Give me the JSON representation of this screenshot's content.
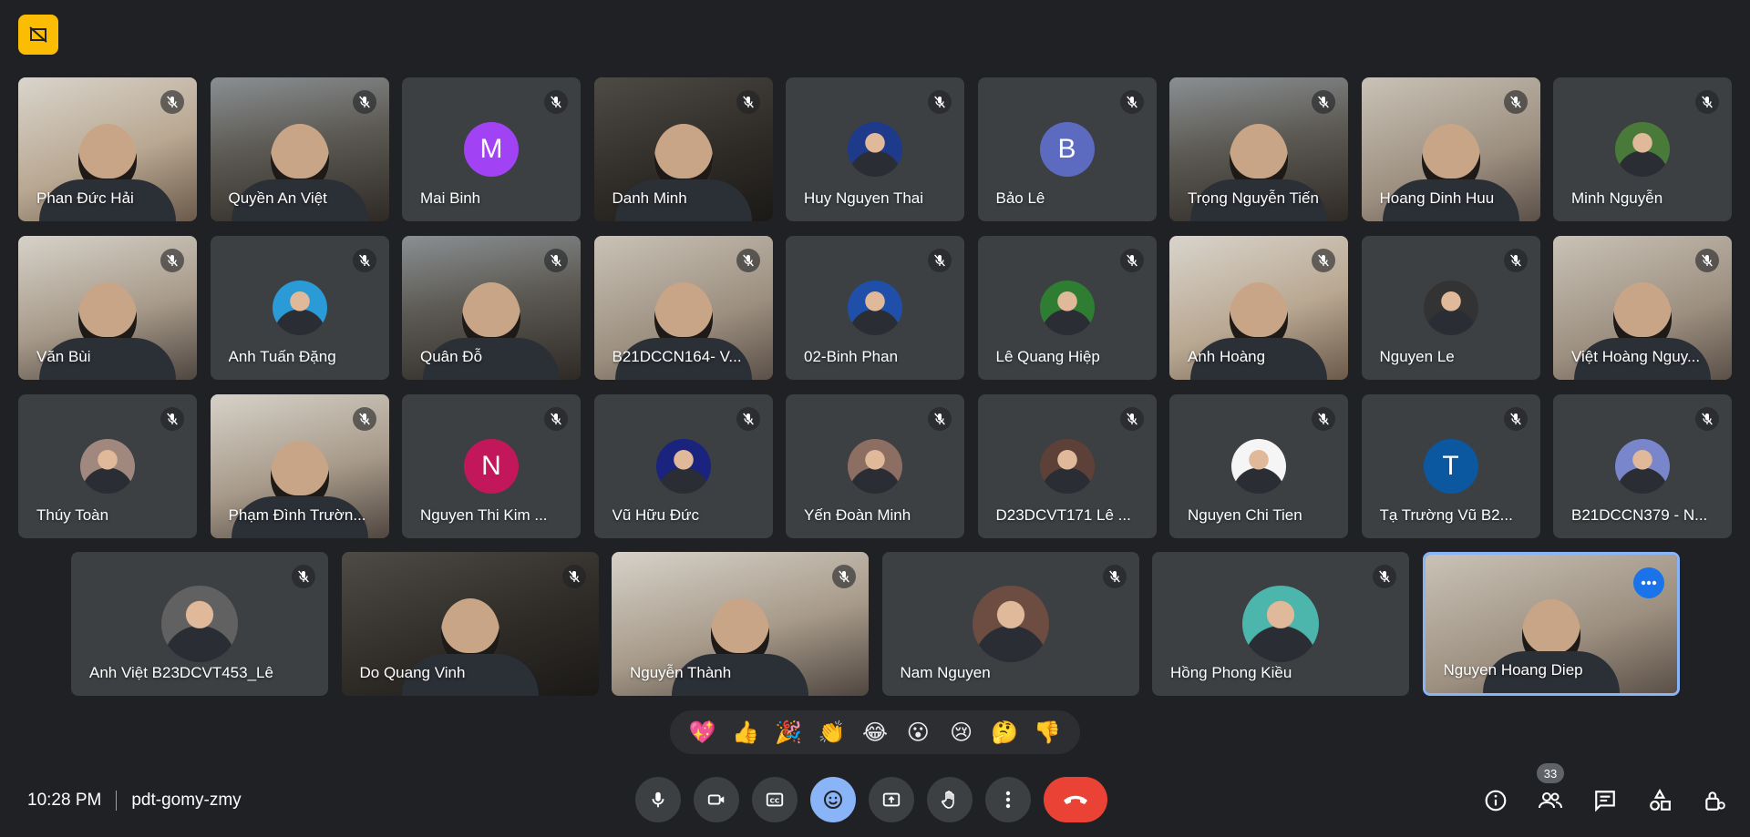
{
  "meeting": {
    "time": "10:28 PM",
    "code": "pdt-gomy-zmy",
    "participant_count": "33"
  },
  "colors": {
    "background": "#202124",
    "tile": "#3c4043",
    "accent_blue": "#8ab4f8",
    "leave_red": "#ea4335",
    "badge_yellow": "#fbbc04"
  },
  "participants": [
    {
      "name": "Phan Đức Hải",
      "kind": "video"
    },
    {
      "name": "Quyền An Việt",
      "kind": "video"
    },
    {
      "name": "Mai Binh",
      "kind": "letter",
      "letter": "M",
      "color": "#a142f4"
    },
    {
      "name": "Danh Minh",
      "kind": "video"
    },
    {
      "name": "Huy Nguyen Thai",
      "kind": "photo",
      "color": "#1e3a8a"
    },
    {
      "name": "Bảo Lê",
      "kind": "letter",
      "letter": "B",
      "color": "#5c6bc0"
    },
    {
      "name": "Trọng Nguyễn Tiến",
      "kind": "video"
    },
    {
      "name": "Hoang Dinh Huu",
      "kind": "video"
    },
    {
      "name": "Minh Nguyễn",
      "kind": "photo",
      "color": "#4a7a3a"
    },
    {
      "name": "Văn Bùi",
      "kind": "video"
    },
    {
      "name": "Anh Tuấn Đặng",
      "kind": "photo",
      "color": "#2a9bd6"
    },
    {
      "name": "Quân Đỗ",
      "kind": "video"
    },
    {
      "name": "B21DCCN164- V...",
      "kind": "video"
    },
    {
      "name": "02-Binh Phan",
      "kind": "photo",
      "color": "#1f4fa8"
    },
    {
      "name": "Lê Quang Hiệp",
      "kind": "photo",
      "color": "#2e7d32"
    },
    {
      "name": "Anh Hoàng",
      "kind": "video"
    },
    {
      "name": "Nguyen Le",
      "kind": "photo",
      "color": "#333333"
    },
    {
      "name": "Việt Hoàng Nguy...",
      "kind": "video"
    },
    {
      "name": "Thúy Toàn",
      "kind": "photo",
      "color": "#a1887f"
    },
    {
      "name": "Phạm Đình Trườn...",
      "kind": "video"
    },
    {
      "name": "Nguyen Thi Kim ...",
      "kind": "letter",
      "letter": "N",
      "color": "#c2185b"
    },
    {
      "name": "Vũ Hữu Đức",
      "kind": "photo",
      "color": "#1a237e"
    },
    {
      "name": "Yến Đoàn Minh",
      "kind": "photo",
      "color": "#8d6e63"
    },
    {
      "name": "D23DCVT171 Lê ...",
      "kind": "photo",
      "color": "#5d4037"
    },
    {
      "name": "Nguyen Chi Tien",
      "kind": "photo",
      "color": "#f5f5f5"
    },
    {
      "name": "Tạ Trường Vũ B2...",
      "kind": "letter",
      "letter": "T",
      "color": "#0b57a0"
    },
    {
      "name": "B21DCCN379 - N...",
      "kind": "photo",
      "color": "#7986cb"
    },
    {
      "name": "Anh Việt B23DCVT453_Lê",
      "kind": "photo",
      "color": "#616161"
    },
    {
      "name": "Do Quang Vinh",
      "kind": "video"
    },
    {
      "name": "Nguyễn Thành",
      "kind": "video"
    },
    {
      "name": "Nam Nguyen",
      "kind": "photo",
      "color": "#6d4c41"
    },
    {
      "name": "Hồng Phong Kiều",
      "kind": "photo",
      "color": "#4db6ac"
    },
    {
      "name": "Nguyen Hoang Diep",
      "kind": "video",
      "active": true
    }
  ],
  "reactions": [
    "💖",
    "👍",
    "🎉",
    "👏",
    "😂",
    "😮",
    "😢",
    "🤔",
    "👎"
  ]
}
